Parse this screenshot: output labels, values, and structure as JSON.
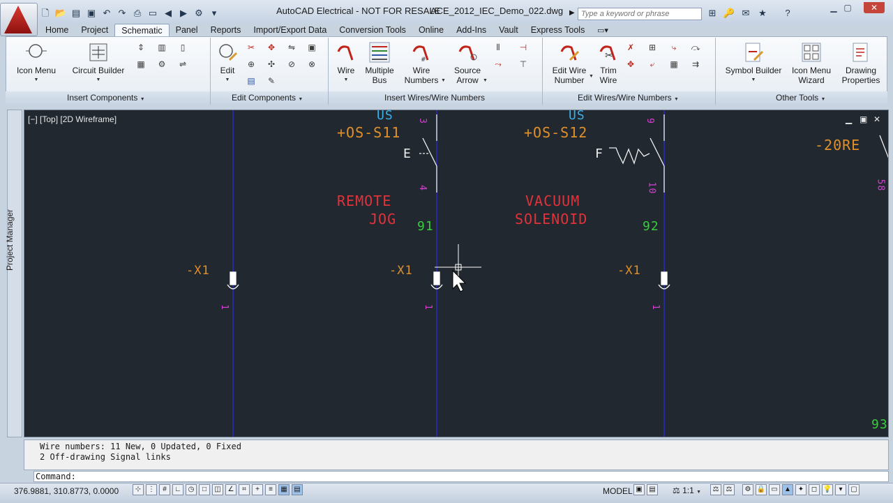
{
  "title": {
    "app": "AutoCAD Electrical - NOT FOR RESALE",
    "file": "ACE_2012_IEC_Demo_022.dwg",
    "search_placeholder": "Type a keyword or phrase"
  },
  "tabs": [
    "Home",
    "Project",
    "Schematic",
    "Panel",
    "Reports",
    "Import/Export Data",
    "Conversion Tools",
    "Online",
    "Add-Ins",
    "Vault",
    "Express Tools"
  ],
  "active_tab": "Schematic",
  "ribbon": {
    "insert_components": {
      "title": "Insert Components",
      "icon_menu": "Icon Menu",
      "circuit_builder": "Circuit Builder"
    },
    "edit_components": {
      "title": "Edit Components",
      "edit": "Edit"
    },
    "insert_wires": {
      "title": "Insert Wires/Wire Numbers",
      "wire": "Wire",
      "multiple_bus_1": "Multiple",
      "multiple_bus_2": "Bus",
      "wire_numbers_1": "Wire",
      "wire_numbers_2": "Numbers",
      "source_arrow_1": "Source",
      "source_arrow_2": "Arrow"
    },
    "edit_wires": {
      "title": "Edit Wires/Wire Numbers",
      "edit_wire_number_1": "Edit Wire",
      "edit_wire_number_2": "Number",
      "trim_wire_1": "Trim",
      "trim_wire_2": "Wire"
    },
    "other_tools": {
      "title": "Other Tools",
      "symbol_builder": "Symbol Builder",
      "icon_menu_wizard_1": "Icon Menu",
      "icon_menu_wizard_2": "Wizard",
      "drawing_properties_1": "Drawing",
      "drawing_properties_2": "Properties"
    }
  },
  "sidebar": {
    "project_manager": "Project Manager"
  },
  "viewport": {
    "label": "[−] [Top] [2D Wireframe]"
  },
  "drawing": {
    "tag_os_left": "US",
    "tag_os_s11": "+OS-S11",
    "tag_os_right": "US",
    "tag_os_s12": "+OS-S12",
    "tag_20re": "-20RE",
    "pin_3": "3",
    "pin_4": "4",
    "pin_9": "9",
    "pin_10": "10",
    "pin_58": "58",
    "switch_e": "E",
    "switch_f": "F",
    "desc_remote_1": "REMOTE",
    "desc_remote_2": "JOG",
    "desc_vacuum_1": "VACUUM",
    "desc_vacuum_2": "SOLENOID",
    "wire_91": "91",
    "wire_92": "92",
    "wire_93": "93",
    "terminal_1": "-X1",
    "terminal_2": "-X1",
    "terminal_3": "-X1",
    "term_pin_1": "1",
    "term_pin_2": "1",
    "term_pin_3": "1"
  },
  "command": {
    "history_1": "Wire numbers: 11 New, 0 Updated, 0 Fixed",
    "history_2": "2 Off-drawing Signal links",
    "prompt": "Command:"
  },
  "status": {
    "coords": "376.9881, 310.8773, 0.0000",
    "model": "MODEL",
    "scale": "1:1"
  },
  "colors": {
    "canvas": "#212830",
    "wire": "#2b2bd6",
    "orange": "#e0902a",
    "red": "#e2323a",
    "green": "#36cf3a",
    "magenta": "#d93fd6",
    "cyan": "#3ab0e8"
  }
}
